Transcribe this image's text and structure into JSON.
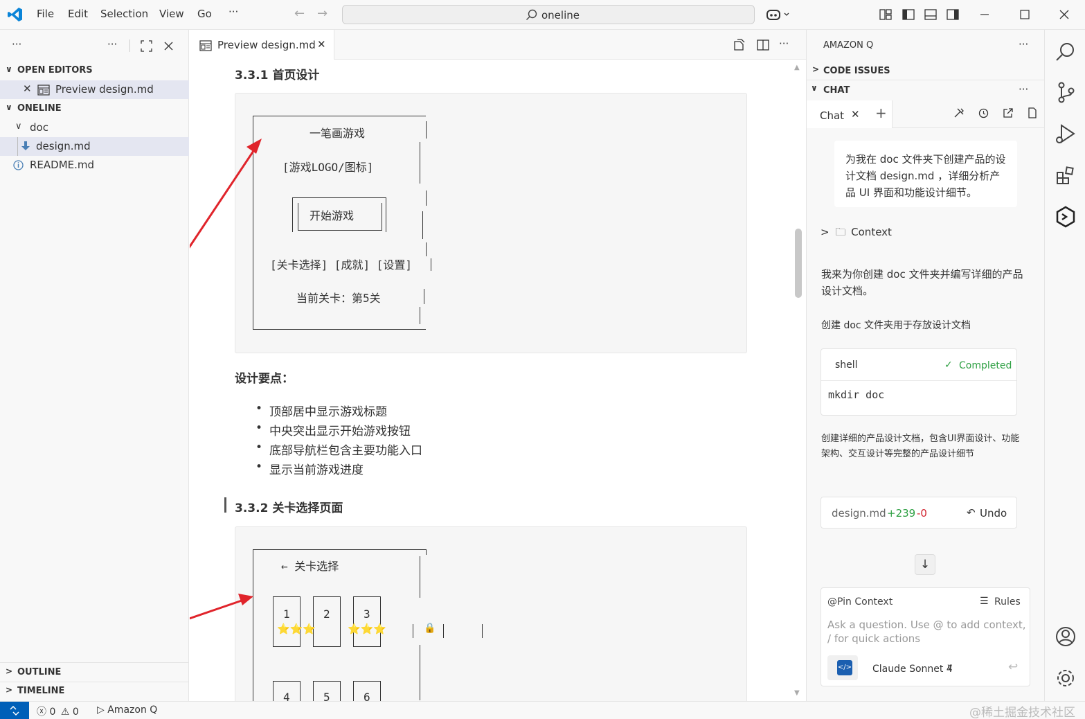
{
  "menu": {
    "file": "File",
    "edit": "Edit",
    "selection": "Selection",
    "view": "View",
    "go": "Go",
    "more": "···"
  },
  "search": {
    "label": "oneline"
  },
  "sidebar": {
    "more": "···",
    "open_editors": "OPEN EDITORS",
    "open_editor_item": "Preview design.md",
    "oneline": "ONELINE",
    "folder_doc": "doc",
    "file_design": "design.md",
    "file_readme": "README.md",
    "outline": "OUTLINE",
    "timeline": "TIMELINE"
  },
  "tab": {
    "label": "Preview design.md"
  },
  "preview": {
    "h_331": "3.3.1 首页设计",
    "home": {
      "title": "一笔画游戏",
      "logo": "[游戏LOGO/图标]",
      "start": "开始游戏",
      "nav": "[关卡选择] [成就] [设置]",
      "level": "当前关卡：第5关"
    },
    "points_title": "设计要点：",
    "points": [
      "顶部居中显示游戏标题",
      "中央突出显示开始游戏按钮",
      "底部导航栏包含主要功能入口",
      "显示当前游戏进度"
    ],
    "h_332": "3.3.2 关卡选择页面",
    "levels": {
      "title": "← 关卡选择",
      "row1": [
        "1",
        "2",
        "3"
      ],
      "row2": [
        "4",
        "5",
        "6"
      ],
      "stars": "⭐⭐⭐",
      "lock": "🔒"
    }
  },
  "amazonq": {
    "title": "AMAZON Q",
    "more": "···",
    "code_issues": "CODE ISSUES",
    "chat": "CHAT",
    "chat_tab": "Chat",
    "user_msg": "为我在 doc 文件夹下创建产品的设计文档 design.md ，详细分析产品 UI 界面和功能设计细节。",
    "context": "Context",
    "reply1": "我来为你创建 doc 文件夹并编写详细的产品设计文档。",
    "reply2": "创建 doc 文件夹用于存放设计文档",
    "shell_label": "shell",
    "shell_status": "Completed",
    "shell_cmd": "mkdir doc",
    "reply3": "创建详细的产品设计文档，包含UI界面设计、功能架构、交互设计等完整的产品设计细节",
    "diff_file": "design.md",
    "diff_add": "+239",
    "diff_del": "-0",
    "undo": "Undo",
    "pin_context": "@Pin Context",
    "rules": "Rules",
    "input_placeholder": "Ask a question. Use @ to add context, / for quick actions",
    "model": "Claude Sonnet 4"
  },
  "status": {
    "errors": "0",
    "warnings": "0",
    "amazonq": "Amazon Q",
    "watermark": "@稀土掘金技术社区"
  },
  "colors": {
    "accent": "#005fb8",
    "arrow": "#e0242b",
    "diff_add": "#2ea043",
    "diff_del": "#d1242f",
    "completed": "#2ea043"
  }
}
